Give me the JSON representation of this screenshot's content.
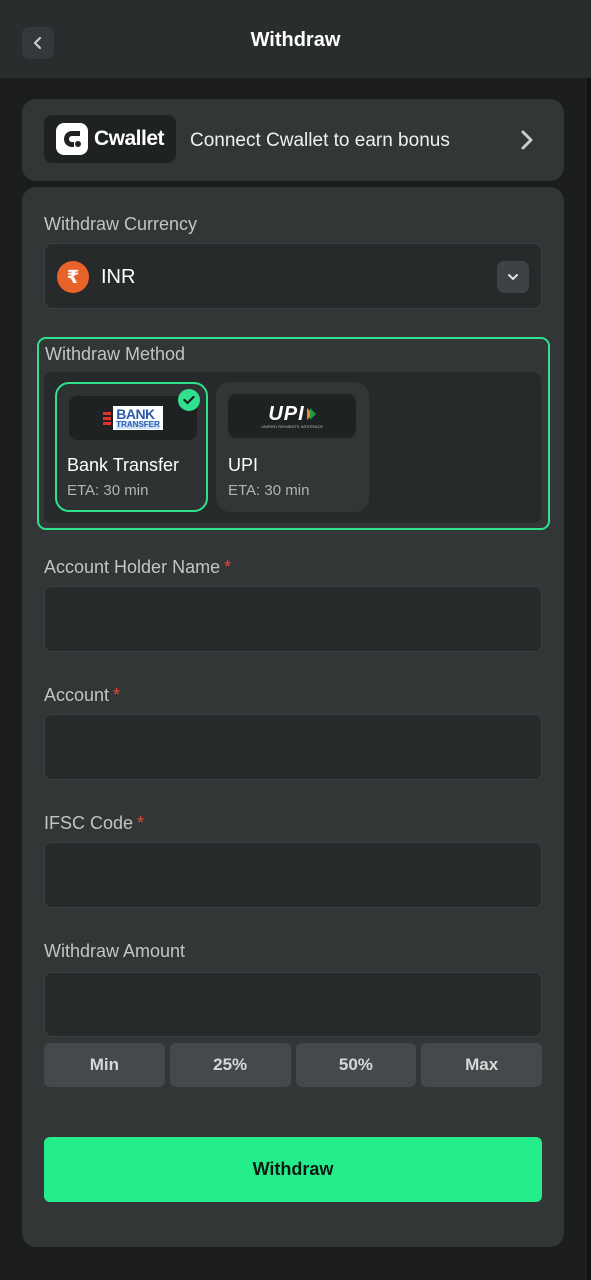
{
  "header": {
    "title": "Withdraw"
  },
  "cwallet_banner": {
    "logo_text": "Cwallet",
    "text": "Connect Cwallet to earn bonus"
  },
  "currency": {
    "label": "Withdraw Currency",
    "symbol": "₹",
    "selected": "INR"
  },
  "method": {
    "label": "Withdraw Method",
    "options": [
      {
        "name": "Bank Transfer",
        "eta": "ETA: 30 min",
        "logo_line1": "BANK",
        "logo_line2": "TRANSFER",
        "selected": true
      },
      {
        "name": "UPI",
        "eta": "ETA: 30 min",
        "logo_text": "UPI",
        "logo_sub": "UNIFIED PAYMENTS INTERFACE",
        "selected": false
      }
    ]
  },
  "fields": {
    "holder_name": {
      "label": "Account Holder Name",
      "required_mark": "*",
      "value": ""
    },
    "account": {
      "label": "Account",
      "required_mark": "*",
      "value": ""
    },
    "ifsc": {
      "label": "IFSC Code",
      "required_mark": "*",
      "value": ""
    },
    "amount": {
      "label": "Withdraw Amount",
      "value": ""
    }
  },
  "amount_buttons": [
    "Min",
    "25%",
    "50%",
    "Max"
  ],
  "submit": {
    "label": "Withdraw"
  },
  "colors": {
    "accent": "#24ee8b",
    "required": "#e5483b",
    "currency_icon": "#e8632a"
  }
}
